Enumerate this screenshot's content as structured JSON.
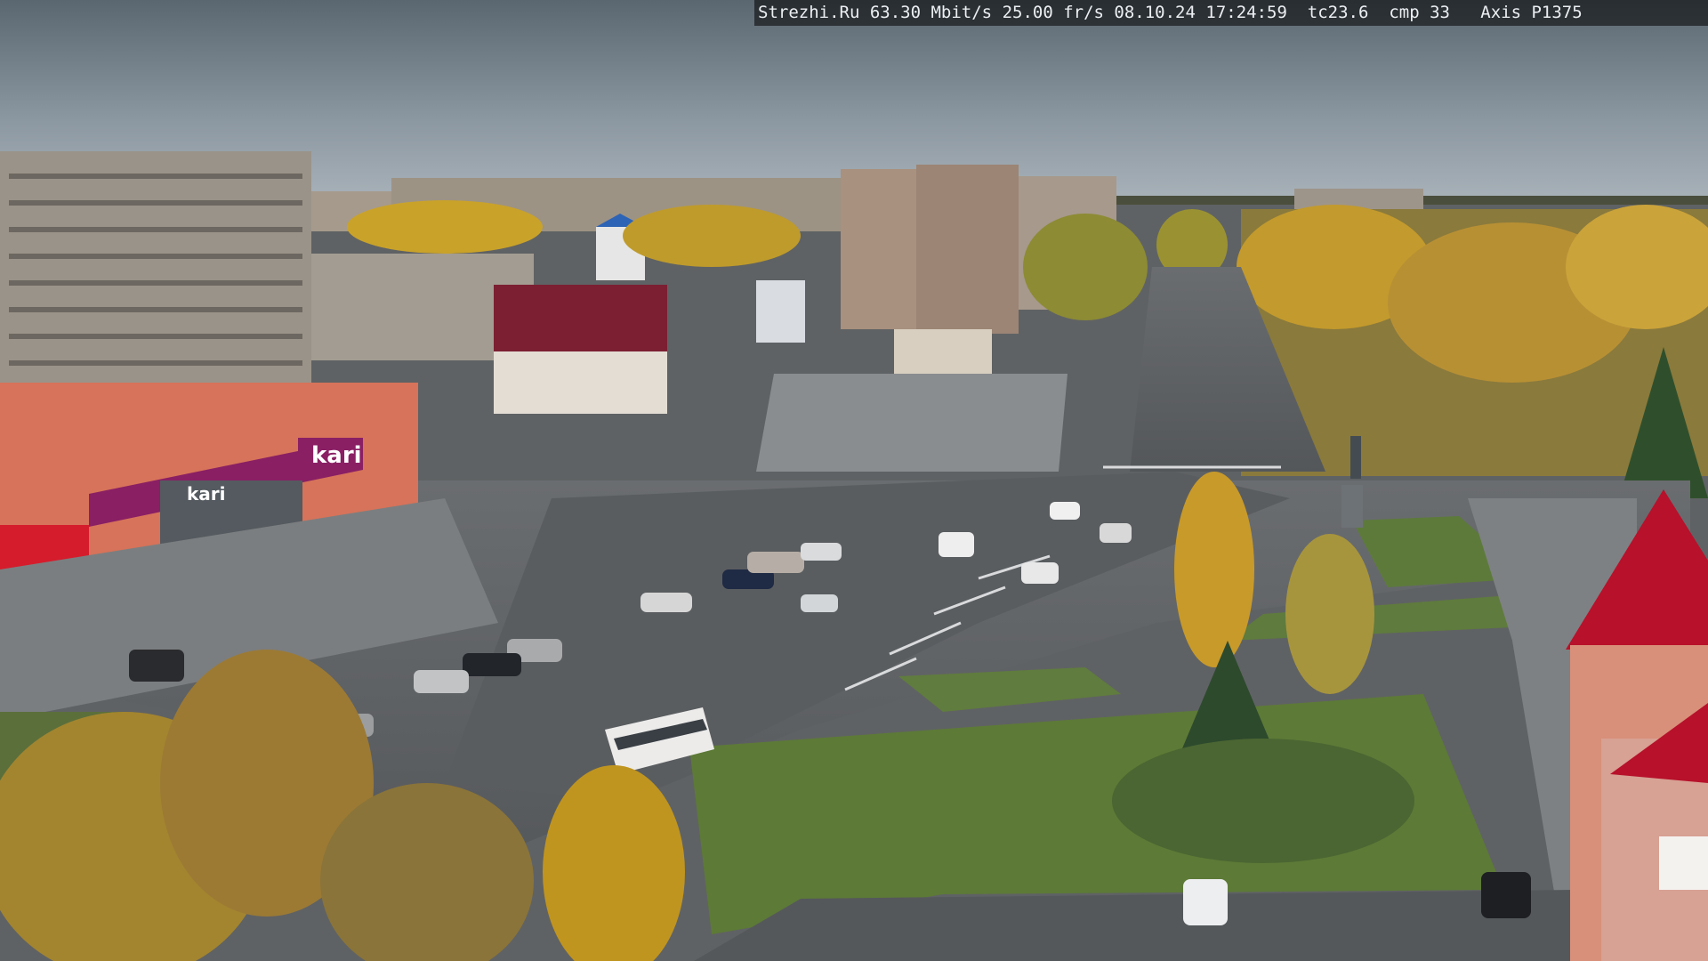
{
  "overlay": {
    "site": "Strezhi.Ru",
    "bitrate": "63.30 Mbit/s",
    "framerate": "25.00 fr/s",
    "date": "08.10.24",
    "time": "17:24:59",
    "tc": "tc23.6",
    "cmp": "cmp 33",
    "camera": "Axis P1375"
  },
  "signs": {
    "kari_main": "kari",
    "kari_lower": "kari"
  },
  "colors": {
    "sky_top": "#5c6770",
    "sky_bottom": "#a7b1b8",
    "kari_magenta": "#8a1f64",
    "roof_red": "#b3102a",
    "autumn_yellow": "#c9a227",
    "grass": "#5c7a3a",
    "asphalt": "#5e6164"
  }
}
